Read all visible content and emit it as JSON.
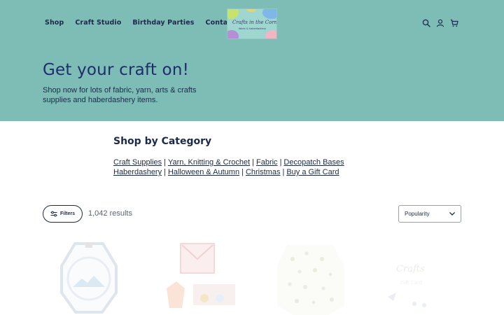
{
  "nav": {
    "items": [
      "Shop",
      "Craft Studio",
      "Birthday Parties",
      "Contact Us"
    ]
  },
  "logo": {
    "line1": "Crafts in the Corner",
    "line2": "fabric & haberdashery"
  },
  "header_icons": [
    "search-icon",
    "account-icon",
    "cart-icon"
  ],
  "hero": {
    "title": "Get your craft on!",
    "subtitle": "Shop now for lots of fabric, yarn, arts & crafts supplies and haberdashery items."
  },
  "categories": {
    "title": "Shop by Category",
    "line1": [
      "Craft Supplies",
      "Yarn, Knitting & Crochet",
      "Fabric",
      "Decopatch Bases"
    ],
    "line2": [
      "Haberdashery",
      "Halloween & Autumn",
      "Christmas",
      "Buy a Gift Card"
    ],
    "separator": "|"
  },
  "toolbar": {
    "filters_label": "Filters",
    "results_text": "1,042 results",
    "sort_value": "Popularity"
  },
  "colors": {
    "hero_bg": "#7dbdb6",
    "text": "#1c2a4a",
    "title": "#1f2e6b"
  }
}
